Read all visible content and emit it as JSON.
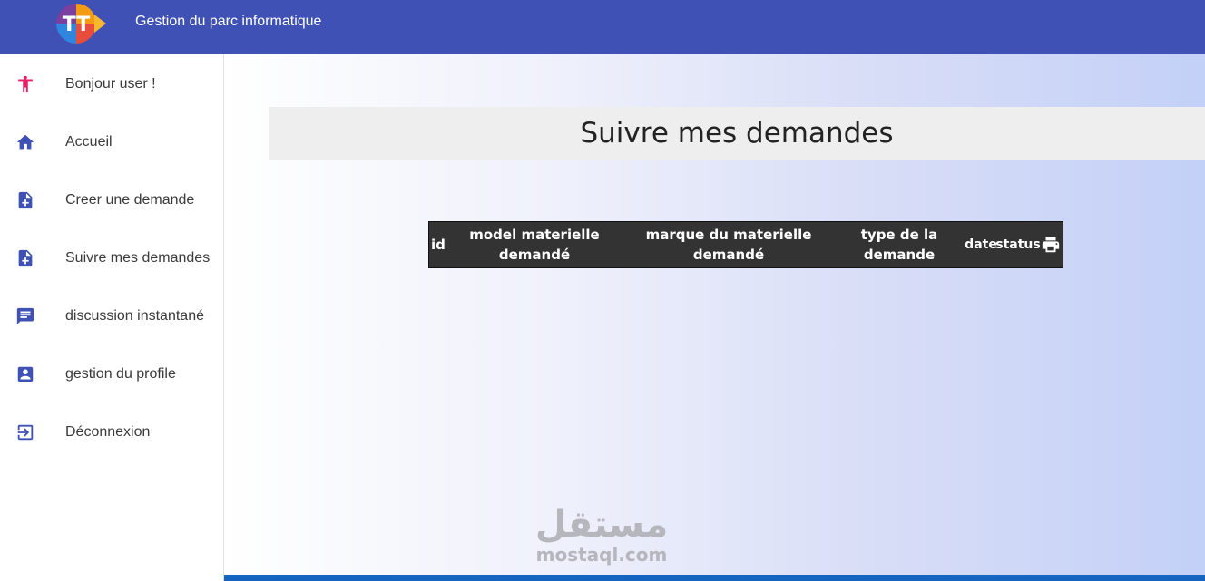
{
  "header": {
    "logo_text": "TT",
    "app_title": "Gestion du parc informatique"
  },
  "sidebar": {
    "items": [
      {
        "label": "Bonjour user !",
        "icon": "person-icon"
      },
      {
        "label": "Accueil",
        "icon": "home-icon"
      },
      {
        "label": "Creer une demande",
        "icon": "note-add-icon"
      },
      {
        "label": "Suivre mes demandes",
        "icon": "note-add-icon"
      },
      {
        "label": "discussion instantané",
        "icon": "chat-icon"
      },
      {
        "label": "gestion du profile",
        "icon": "account-box-icon"
      },
      {
        "label": "Déconnexion",
        "icon": "logout-icon"
      }
    ]
  },
  "main": {
    "page_title": "Suivre mes demandes",
    "table": {
      "columns": [
        "id",
        "model materielle demandé",
        "marque du materielle demandé",
        "type de la demande",
        "date",
        "status"
      ],
      "rows": []
    }
  },
  "watermark": {
    "arabic": "مستقل",
    "latin": "mostaql.com"
  },
  "colors": {
    "header": "#3f51b5",
    "sidebar_icon": "#3f51b5",
    "user_icon": "#e91e63",
    "table_header": "#333333",
    "bottom_bar": "#1565c0"
  }
}
